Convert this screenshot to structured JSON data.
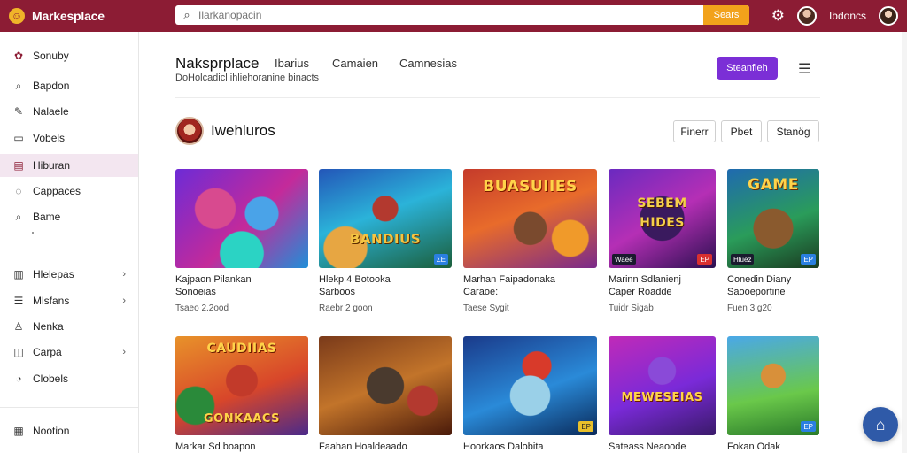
{
  "app": {
    "brand": "Markesplace",
    "search_placeholder": "Ilarkanopacin",
    "search_button": "Sears",
    "user_name": "Ibdoncs"
  },
  "sidebar": {
    "items": [
      {
        "label": "Sonuby",
        "icon": "gear-icon"
      },
      {
        "label": "Bapdon",
        "icon": "search-icon"
      },
      {
        "label": "Nalaele",
        "icon": "pen-icon"
      },
      {
        "label": "Vobels",
        "icon": "folder-icon"
      },
      {
        "label": "Hiburan",
        "icon": "grid-icon"
      },
      {
        "label": "Cappaces",
        "icon": "compass-icon"
      },
      {
        "label": "Bame",
        "icon": "search-icon"
      },
      {
        "label": "Hlelepas",
        "icon": "layout-icon"
      },
      {
        "label": "Mlsfans",
        "icon": "list-icon"
      },
      {
        "label": "Nenka",
        "icon": "user-icon"
      },
      {
        "label": "Carpa",
        "icon": "lock-icon"
      },
      {
        "label": "Clobels",
        "icon": "chat-icon"
      },
      {
        "label": "Nootion",
        "icon": "calendar-icon"
      }
    ]
  },
  "header": {
    "title": "Naksprplace",
    "tabs": [
      "Ibarius",
      "Camaien",
      "Camnesias"
    ],
    "subtitle": "DoHolcadicl ihliehoranine binacts",
    "cta_label": "Steanfieh"
  },
  "section": {
    "title": "Iwehluros",
    "filters": [
      "Finerr",
      "Pbet",
      "Stanög"
    ]
  },
  "cards": [
    {
      "title": "Kajpaon Pilankan\nSonoeias",
      "meta": "Tsaeo 2.2ood",
      "badge": ""
    },
    {
      "title": "Hlekp 4 Botooka\nSarboos",
      "meta": "Raebr 2 goon",
      "badge": "ΣE",
      "art": "BANDIUS"
    },
    {
      "title": "Marhan Faipadonaka\nCaraoe:",
      "meta": "Taese Sygit",
      "badge": "",
      "art": "BUASUIIES"
    },
    {
      "title": "Marinn Sdlanienj\nCaper Roadde",
      "meta": "Tuidr Sigab",
      "badge": "EP",
      "art": "SEBEM HIDES",
      "label": "Waee"
    },
    {
      "title": "Conedin Diany\nSaooeportine",
      "meta": "Fuen 3 g20",
      "badge": "EP",
      "art": "GAME",
      "label": "Hluez"
    },
    {
      "title": "Markar Sd boapon",
      "meta": "",
      "badge": "",
      "art": "CAUDIIAS",
      "art2": "GONKAACS"
    },
    {
      "title": "Faahan Hoaldeaado",
      "meta": "",
      "badge": "",
      "art": ""
    },
    {
      "title": "Hoorkaos Dalobita",
      "meta": "",
      "badge": "EP",
      "art": ""
    },
    {
      "title": "Sateass Neaoode",
      "meta": "",
      "badge": "",
      "art": "MEWESEIAS"
    },
    {
      "title": "Fokan Odak",
      "meta": "",
      "badge": "EP",
      "art": ""
    }
  ],
  "colors": {
    "topbar": "#8c1c34",
    "accent": "#7b2fd6",
    "search_button": "#f2a21b",
    "active_nav": "#f3e6f0",
    "fab": "#2f5aa8"
  }
}
